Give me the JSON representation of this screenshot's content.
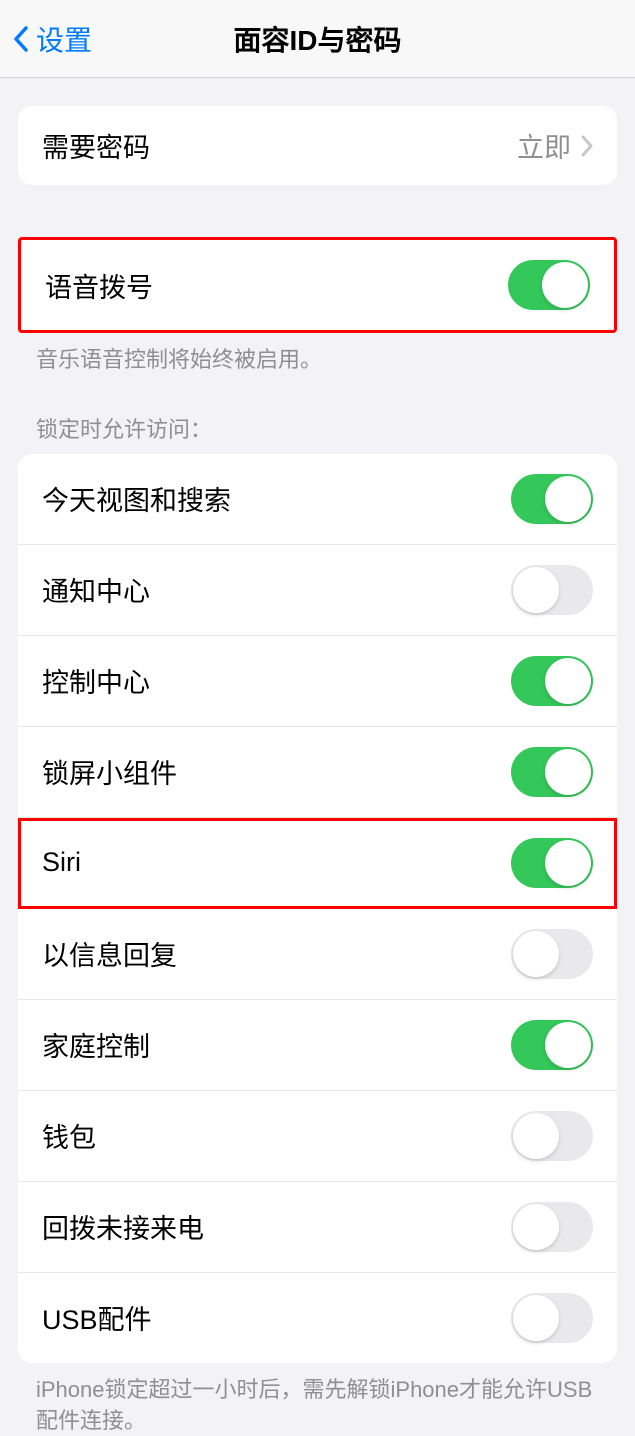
{
  "header": {
    "back_label": "设置",
    "title": "面容ID与密码"
  },
  "require_passcode": {
    "label": "需要密码",
    "value": "立即"
  },
  "voice_dial": {
    "label": "语音拨号",
    "enabled": true,
    "footer": "音乐语音控制将始终被启用。"
  },
  "locked_access": {
    "header": "锁定时允许访问：",
    "items": [
      {
        "label": "今天视图和搜索",
        "enabled": true
      },
      {
        "label": "通知中心",
        "enabled": false
      },
      {
        "label": "控制中心",
        "enabled": true
      },
      {
        "label": "锁屏小组件",
        "enabled": true
      },
      {
        "label": "Siri",
        "enabled": true
      },
      {
        "label": "以信息回复",
        "enabled": false
      },
      {
        "label": "家庭控制",
        "enabled": true
      },
      {
        "label": "钱包",
        "enabled": false
      },
      {
        "label": "回拨未接来电",
        "enabled": false
      },
      {
        "label": "USB配件",
        "enabled": false
      }
    ],
    "footer": "iPhone锁定超过一小时后，需先解锁iPhone才能允许USB配件连接。"
  }
}
